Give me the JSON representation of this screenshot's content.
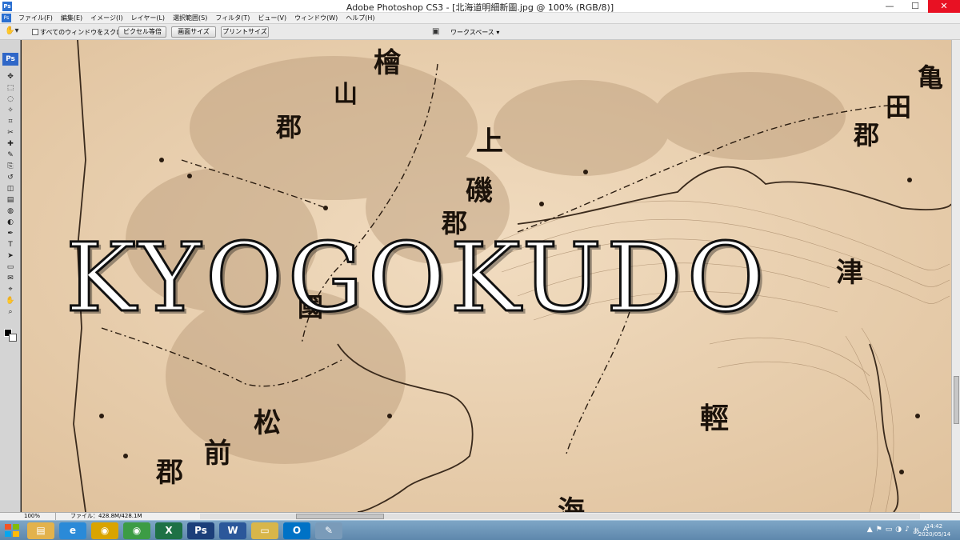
{
  "window": {
    "app_icon": "Ps",
    "title": "Adobe Photoshop CS3 - [北海道明細新圖.jpg @ 100% (RGB/8)]",
    "controls": {
      "minimize": "—",
      "maximize": "☐",
      "close": "✕"
    }
  },
  "menu": {
    "items": [
      "ファイル(F)",
      "編集(E)",
      "イメージ(I)",
      "レイヤー(L)",
      "選択範囲(S)",
      "フィルタ(T)",
      "ビュー(V)",
      "ウィンドウ(W)",
      "ヘルプ(H)"
    ]
  },
  "options": {
    "scroll_all_label": "すべてのウィンドウをスクロール",
    "actual_pixels": "ピクセル等倍",
    "fit_screen": "画面サイズ",
    "print_size": "プリントサイズ",
    "workspace": "ワークスペース ▾"
  },
  "toolbox": {
    "logo": "Ps",
    "tools": [
      "move-tool-icon",
      "marquee-tool-icon",
      "lasso-tool-icon",
      "magic-wand-tool-icon",
      "crop-tool-icon",
      "slice-tool-icon",
      "healing-brush-tool-icon",
      "brush-tool-icon",
      "clone-stamp-tool-icon",
      "history-brush-tool-icon",
      "eraser-tool-icon",
      "gradient-tool-icon",
      "blur-tool-icon",
      "dodge-tool-icon",
      "pen-tool-icon",
      "type-tool-icon",
      "path-selection-tool-icon",
      "shape-tool-icon",
      "notes-tool-icon",
      "eyedropper-tool-icon",
      "hand-tool-icon",
      "zoom-tool-icon"
    ],
    "glyphs": [
      "✥",
      "⬚",
      "◌",
      "✧",
      "⌗",
      "✂",
      "✚",
      "✎",
      "⎘",
      "↺",
      "◫",
      "▤",
      "◍",
      "◐",
      "✒",
      "T",
      "➤",
      "▭",
      "✉",
      "⌖",
      "✋",
      "⌕"
    ],
    "foreground_color": "#000000",
    "background_color": "#ffffff"
  },
  "canvas": {
    "watermark": "KYOGOKUDO",
    "map_labels": [
      "檜",
      "山",
      "郡",
      "上",
      "磯",
      "郡",
      "國",
      "津",
      "輕",
      "松",
      "前",
      "郡",
      "海",
      "亀",
      "田",
      "郡"
    ],
    "paper_color": "#e9d0b0",
    "ink_color": "#3a2a1c"
  },
  "status": {
    "zoom": "100%",
    "file_info": "ファイル：428.8M/428.1M"
  },
  "taskbar": {
    "apps": [
      {
        "name": "file-explorer-icon",
        "glyph": "▤",
        "color": "#e2b24c"
      },
      {
        "name": "internet-explorer-icon",
        "glyph": "e",
        "color": "#2a8ad8"
      },
      {
        "name": "chrome-icon",
        "glyph": "◉",
        "color": "#d9a400"
      },
      {
        "name": "chrome-icon-2",
        "glyph": "◉",
        "color": "#3c9c45"
      },
      {
        "name": "excel-icon",
        "glyph": "X",
        "color": "#1e7145"
      },
      {
        "name": "photoshop-icon",
        "glyph": "Ps",
        "color": "#1c3f7a"
      },
      {
        "name": "word-icon",
        "glyph": "W",
        "color": "#2b579a"
      },
      {
        "name": "folder-icon",
        "glyph": "▭",
        "color": "#d8b64a"
      },
      {
        "name": "outlook-icon",
        "glyph": "O",
        "color": "#0072c6"
      },
      {
        "name": "paint-icon",
        "glyph": "✎",
        "color": "#7a9bb9"
      }
    ],
    "tray": [
      "▲",
      "⚑",
      "▭",
      "◑",
      "♪",
      "あ",
      "A"
    ],
    "time": "14:42",
    "date": "2020/05/14"
  }
}
